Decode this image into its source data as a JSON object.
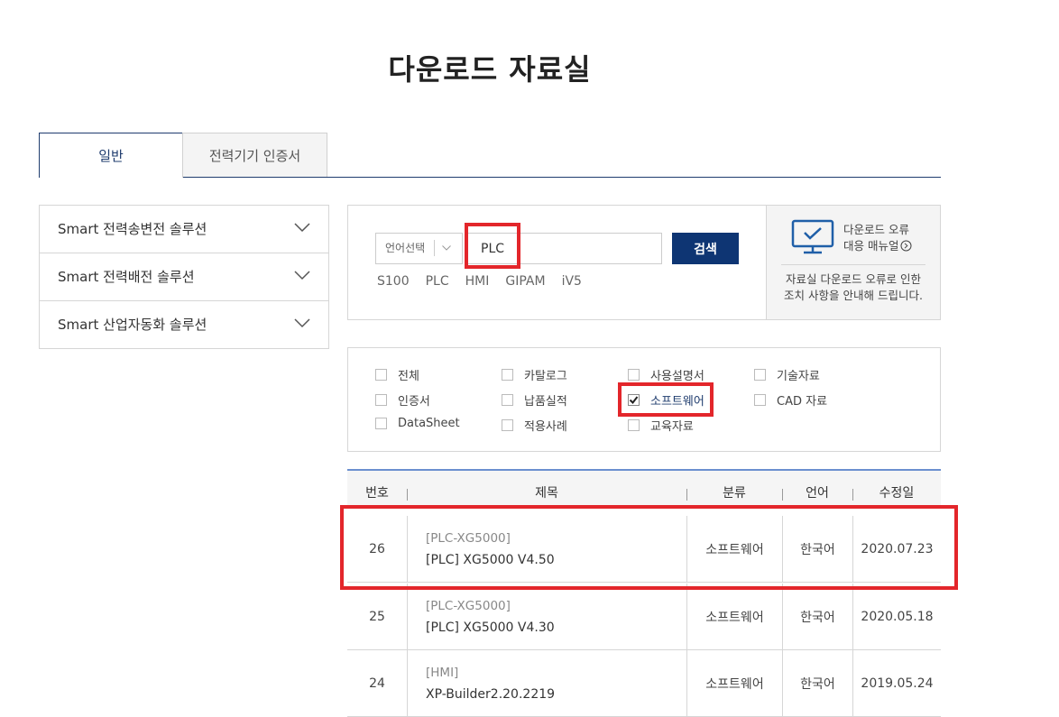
{
  "page": {
    "title": "다운로드 자료실"
  },
  "tabs": [
    {
      "label": "일반",
      "active": true
    },
    {
      "label": "전력기기 인증서",
      "active": false
    }
  ],
  "sidebar": {
    "items": [
      {
        "label": "Smart 전력송변전 솔루션"
      },
      {
        "label": "Smart 전력배전 솔루션"
      },
      {
        "label": "Smart 산업자동화 솔루션"
      }
    ]
  },
  "search": {
    "language_select": "언어선택",
    "query": "PLC",
    "button": "검색",
    "quick_links": [
      "S100",
      "PLC",
      "HMI",
      "GIPAM",
      "iV5"
    ]
  },
  "help": {
    "title_line1": "다운로드 오류",
    "title_line2": "대응 매뉴얼",
    "desc_line1": "자료실 다운로드 오류로 인한",
    "desc_line2": "조치 사항을 안내해 드립니다."
  },
  "filters": [
    {
      "label": "전체",
      "checked": false
    },
    {
      "label": "카탈로그",
      "checked": false
    },
    {
      "label": "사용설명서",
      "checked": false
    },
    {
      "label": "기술자료",
      "checked": false
    },
    {
      "label": "인증서",
      "checked": false
    },
    {
      "label": "납품실적",
      "checked": false
    },
    {
      "label": "소프트웨어",
      "checked": true
    },
    {
      "label": "CAD 자료",
      "checked": false
    },
    {
      "label": "DataSheet",
      "checked": false
    },
    {
      "label": "적용사례",
      "checked": false
    },
    {
      "label": "교육자료",
      "checked": false
    }
  ],
  "table": {
    "headers": {
      "no": "번호",
      "title": "제목",
      "category": "분류",
      "language": "언어",
      "date": "수정일"
    },
    "rows": [
      {
        "no": "26",
        "tag": "[PLC-XG5000]",
        "title": "[PLC] XG5000 V4.50",
        "category": "소프트웨어",
        "language": "한국어",
        "date": "2020.07.23"
      },
      {
        "no": "25",
        "tag": "[PLC-XG5000]",
        "title": "[PLC] XG5000 V4.30",
        "category": "소프트웨어",
        "language": "한국어",
        "date": "2020.05.18"
      },
      {
        "no": "24",
        "tag": "[HMI]",
        "title": "XP-Builder2.20.2219",
        "category": "소프트웨어",
        "language": "한국어",
        "date": "2019.05.24"
      }
    ]
  },
  "colors": {
    "brand_navy": "#0e3573",
    "highlight_red": "#e3262b",
    "table_top": "#6b8fcf"
  }
}
